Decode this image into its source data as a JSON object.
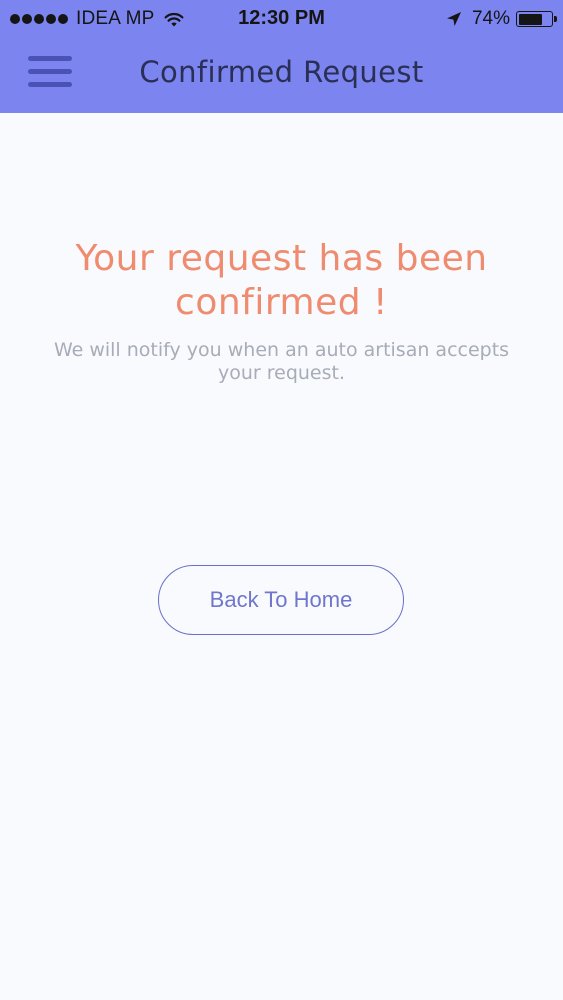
{
  "status_bar": {
    "carrier": "IDEA MP",
    "time": "12:30 PM",
    "battery_percent": "74%",
    "battery_level": 0.74,
    "signal_strength": 5
  },
  "header": {
    "title": "Confirmed Request",
    "menu_icon": "hamburger-menu-icon",
    "background_color": "#7b84ef"
  },
  "main": {
    "headline": "Your request has been confirmed !",
    "subtext": "We will notify you when an auto artisan accepts your request.",
    "back_button_label": "Back To Home"
  },
  "colors": {
    "accent": "#7b84ef",
    "headline": "#ef8b6e",
    "button_border": "#6a70c8"
  }
}
